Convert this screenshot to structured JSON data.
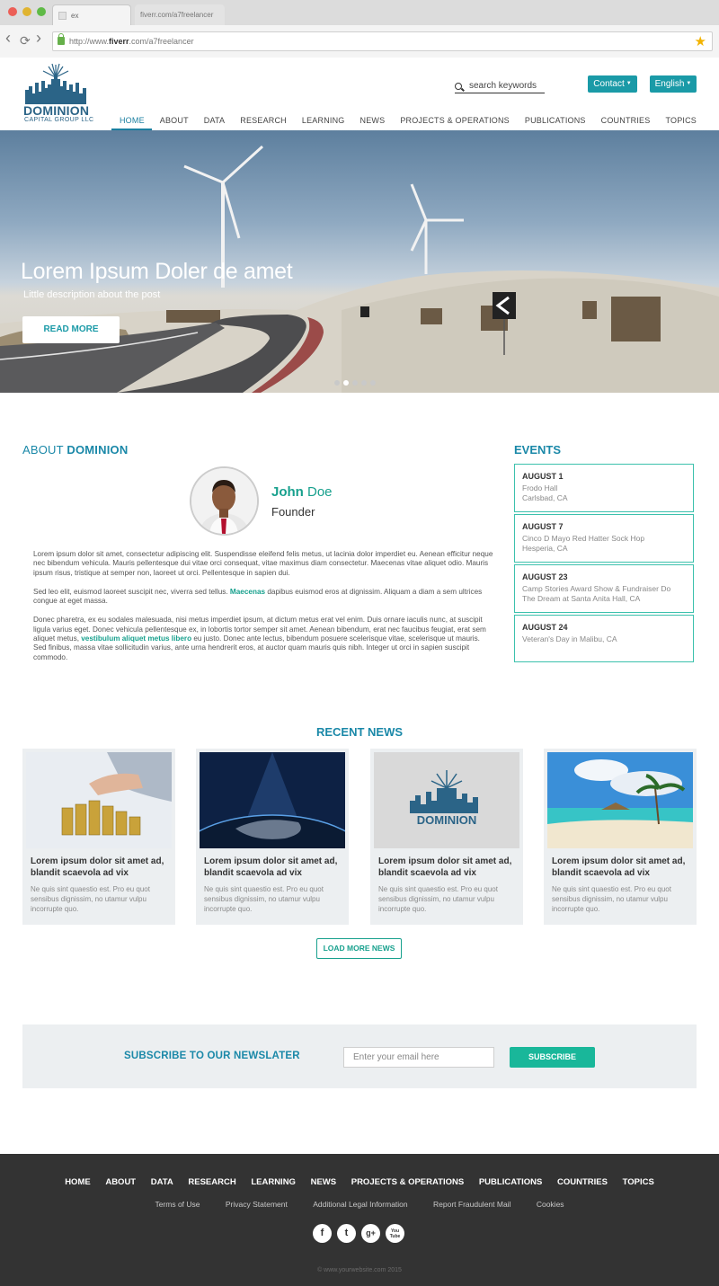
{
  "browser": {
    "tab_title": "ex",
    "tab2_title": "fiverr.com/a7freelancer",
    "url_prefix": "http://www.",
    "url_domain": "fiverr",
    "url_suffix": ".com/a7freelancer",
    "back_icon": "‹",
    "reload_icon": "⟳",
    "forward_icon": "›",
    "bookmark_icon": "★"
  },
  "header": {
    "logo_word": "DOMINION",
    "logo_sub": "CAPITAL GROUP LLC",
    "search_placeholder": "search keywords",
    "contact_label": "Contact",
    "language_label": "English",
    "caret": "▼"
  },
  "nav": {
    "items": [
      {
        "label": "HOME"
      },
      {
        "label": "ABOUT"
      },
      {
        "label": "DATA"
      },
      {
        "label": "RESEARCH"
      },
      {
        "label": "LEARNING"
      },
      {
        "label": "NEWS"
      },
      {
        "label": "PROJECTS & OPERATIONS"
      },
      {
        "label": "PUBLICATIONS"
      },
      {
        "label": "COUNTRIES"
      },
      {
        "label": "TOPICS"
      }
    ],
    "active_index": 0
  },
  "hero": {
    "title": "Lorem Ipsum Doler de amet",
    "description": "Little description about the post",
    "button_label": "READ MORE",
    "slide_count": 5,
    "active_slide": 1
  },
  "about": {
    "title_light": "ABOUT ",
    "title_bold": "DOMINION",
    "first_name": "John",
    "last_name": " Doe",
    "role": "Founder",
    "p1": "Lorem ipsum dolor sit amet, consectetur adipiscing elit. Suspendisse eleifend felis metus, ut lacinia dolor imperdiet eu. Aenean efficitur neque nec bibendum vehicula. Mauris pellentesque dui vitae orci consequat, vitae maximus diam consectetur. Maecenas vitae aliquet odio. Mauris ipsum risus, tristique at semper non, laoreet ut orci. Pellentesque in sapien dui.",
    "p2_a": "Sed leo elit, euismod laoreet suscipit nec, viverra sed tellus. ",
    "p2_hl": "Maecenas",
    "p2_b": " dapibus euismod eros at dignissim. Aliquam a diam a sem ultrices congue at eget massa.",
    "p3_a": "Donec pharetra, ex eu sodales malesuada, nisi metus imperdiet ipsum, at dictum metus erat vel enim. Duis ornare iaculis nunc, at suscipit ligula varius eget. Donec vehicula pellentesque ex, in lobortis tortor semper sit amet. Aenean bibendum, erat nec faucibus feugiat, erat sem aliquet metus, ",
    "p3_hl": "vestibulum aliquet metus libero",
    "p3_b": " eu justo. Donec ante lectus, bibendum posuere scelerisque vitae, scelerisque ut mauris. Sed finibus, massa vitae sollicitudin varius, ante urna hendrerit eros, at auctor quam mauris quis nibh. Integer ut orci in sapien suscipit commodo."
  },
  "events": {
    "title": "EVENTS",
    "items": [
      {
        "date": "AUGUST 1",
        "line1": "Frodo Hall",
        "line2": "Carlsbad, CA"
      },
      {
        "date": "AUGUST 7",
        "line1": "Cinco D Mayo Red Hatter Sock Hop",
        "line2": "Hesperia, CA"
      },
      {
        "date": "AUGUST 23",
        "line1": "Camp Stories Award Show & Fundraiser Do",
        "line2": "The Dream at Santa Anita Hall, CA"
      },
      {
        "date": "AUGUST 24",
        "line1": "Veteran's Day in Malibu, CA",
        "line2": ""
      }
    ]
  },
  "news": {
    "title": "RECENT NEWS",
    "items": [
      {
        "title": "Lorem ipsum dolor sit amet ad, blandit scaevola ad vix",
        "body": "Ne quis sint quaestio est. Pro eu quot sensibus dignissim, no utamur vulpu incorrupte quo."
      },
      {
        "title": "Lorem ipsum dolor sit amet ad, blandit scaevola ad vix",
        "body": "Ne quis sint quaestio est. Pro eu quot sensibus dignissim, no utamur vulpu incorrupte quo."
      },
      {
        "title": "Lorem ipsum dolor sit amet ad, blandit scaevola ad vix",
        "body": "Ne quis sint quaestio est. Pro eu quot sensibus dignissim, no utamur vulpu incorrupte quo."
      },
      {
        "title": "Lorem ipsum dolor sit amet ad, blandit scaevola ad vix",
        "body": "Ne quis sint quaestio est. Pro eu quot sensibus dignissim, no utamur vulpu incorrupte quo."
      }
    ],
    "load_more_label": "LOAD MORE NEWS"
  },
  "subscribe": {
    "title": "SUBSCRIBE TO OUR NEWSLATER",
    "placeholder": "Enter your email here",
    "button_label": "SUBSCRIBE"
  },
  "footer": {
    "nav": [
      "HOME",
      "ABOUT",
      "DATA",
      "RESEARCH",
      "LEARNING",
      "NEWS",
      "PROJECTS & OPERATIONS",
      "PUBLICATIONS",
      "COUNTRIES",
      "TOPICS"
    ],
    "legal": [
      "Terms of Use",
      "Privacy Statement",
      "Additional Legal Information",
      "Report Fraudulent Mail",
      "Cookies"
    ],
    "social": [
      {
        "icon": "facebook-icon",
        "glyph": "f"
      },
      {
        "icon": "twitter-icon",
        "glyph": "t"
      },
      {
        "icon": "google-plus-icon",
        "glyph": "g+"
      },
      {
        "icon": "youtube-icon",
        "glyph": "You Tube"
      }
    ],
    "copyright": "© www.yourwebsite.com  2015"
  },
  "colors": {
    "brand_teal": "#1a9aa7",
    "heading_blue": "#1a88a8",
    "accent_green": "#17a08d",
    "footer_bg": "#333333"
  }
}
